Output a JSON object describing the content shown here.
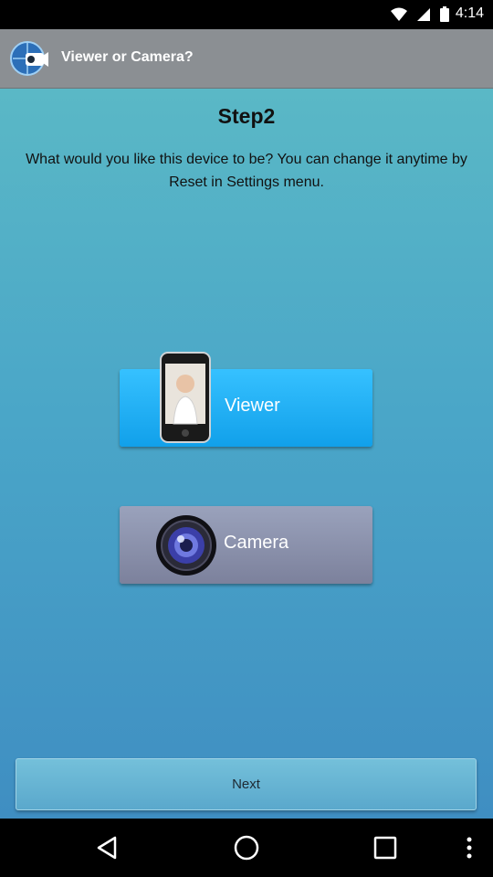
{
  "status_bar": {
    "time": "4:14"
  },
  "app_bar": {
    "title": "Viewer or Camera?"
  },
  "step": {
    "title": "Step2",
    "description": "What would you like this device to be? You can change it anytime by Reset in Settings menu."
  },
  "choices": {
    "viewer_label": "Viewer",
    "camera_label": "Camera"
  },
  "footer": {
    "next_label": "Next"
  },
  "colors": {
    "app_bar": "#8b8f93",
    "viewer_button": "#11a0ea",
    "camera_button": "#7c819c",
    "background_top": "#5ab8c6",
    "background_bottom": "#3f8ec2"
  },
  "icons": [
    "app-logo-icon",
    "wifi-icon",
    "signal-icon",
    "battery-icon",
    "phone-icon",
    "camera-lens-icon",
    "back-icon",
    "home-icon",
    "recents-icon",
    "overflow-menu-icon"
  ]
}
